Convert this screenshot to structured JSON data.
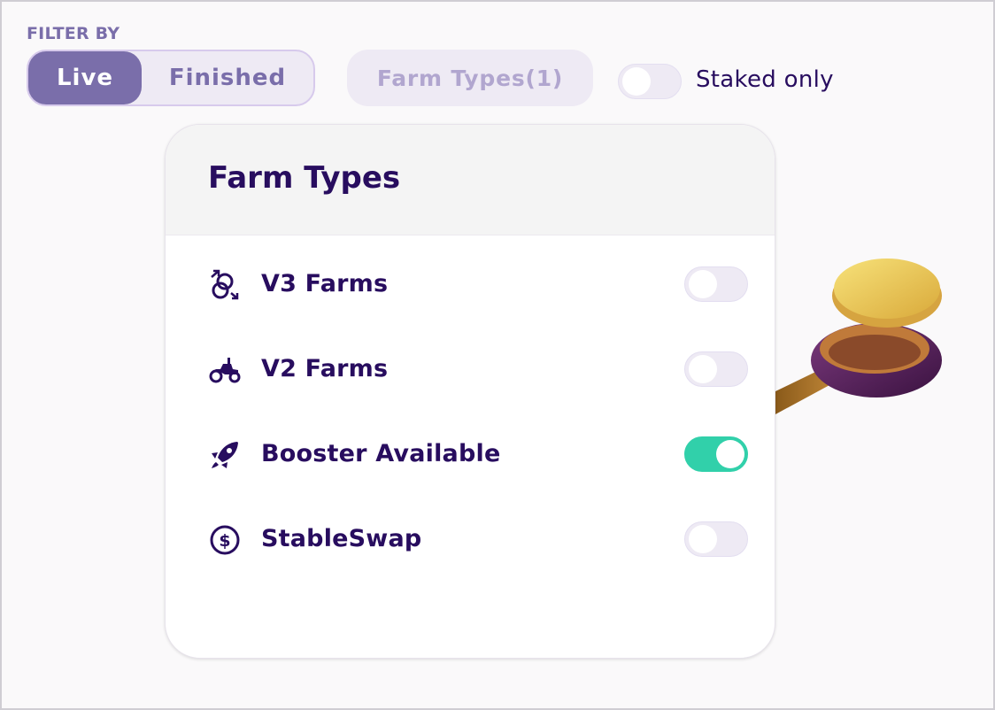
{
  "filter": {
    "label": "FILTER BY",
    "segment": {
      "live_label": "Live",
      "finished_label": "Finished",
      "selected": "Live"
    },
    "farm_types_button": "Farm Types(1)",
    "staked_only": {
      "label": "Staked only",
      "checked": false
    }
  },
  "dropdown": {
    "title": "Farm Types",
    "items": [
      {
        "label": "V3 Farms",
        "icon": "v3-farms-icon",
        "checked": false
      },
      {
        "label": "V2 Farms",
        "icon": "tractor-icon",
        "checked": false
      },
      {
        "label": "Booster Available",
        "icon": "rocket-icon",
        "checked": true
      },
      {
        "label": "StableSwap",
        "icon": "dollar-circle-icon",
        "checked": false
      }
    ]
  },
  "colors": {
    "primary_text": "#280d5f",
    "secondary": "#7a6eaa",
    "toggle_on": "#31d0aa",
    "toggle_off": "#eeeaf4"
  }
}
